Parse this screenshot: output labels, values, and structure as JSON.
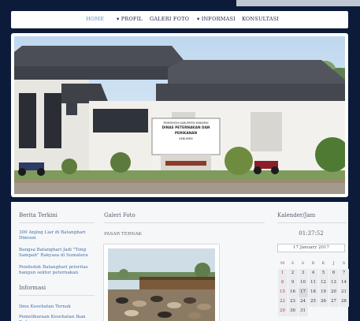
{
  "nav": {
    "items": [
      {
        "label": "HOME",
        "active": true
      },
      {
        "label": "▾ PROFIL"
      },
      {
        "label": "GALERI FOTO"
      },
      {
        "label": "▾ INFORMASI"
      },
      {
        "label": "KONSULTASI"
      }
    ]
  },
  "hero": {
    "building_sign_lines": [
      "PEMERINTAH KABUPATEN KEBUMEN",
      "DINAS PETERNAKAN DAN PERIKANAN",
      "",
      "KEBUMEN"
    ]
  },
  "berita": {
    "title": "Berita Terkini",
    "links": [
      "300 Anjing Liar di Batanghari Dimusn",
      "Bangsa Batanghari Jadi \"Tong Sampah\" Rakyasa di Sumatera",
      "Penduduk Batanghari prioritas bangun sektor peternakan"
    ],
    "info_title": "Informasi",
    "info_links": [
      "Ilmu Kesehatan Ternak",
      "Pemeliharaan Kesehatan Ikan Pada"
    ]
  },
  "galeri": {
    "title": "Galeri Foto",
    "caption": "PASAR TERNAK"
  },
  "kalender": {
    "title": "Kalender/Jam",
    "clock": "01:37:52",
    "date_value": "17 January 2017",
    "day_headers": [
      "M",
      "S",
      "S",
      "R",
      "K",
      "J",
      "S"
    ],
    "weeks": [
      [
        "1",
        "2",
        "3",
        "4",
        "5",
        "6",
        "7"
      ],
      [
        "8",
        "9",
        "10",
        "11",
        "12",
        "13",
        "14"
      ],
      [
        "15",
        "16",
        "17",
        "18",
        "19",
        "20",
        "21"
      ],
      [
        "22",
        "23",
        "24",
        "25",
        "26",
        "27",
        "28"
      ],
      [
        "29",
        "30",
        "31",
        "",
        "",
        "",
        ""
      ]
    ],
    "today": "17"
  },
  "colors": {
    "background": "#0c1b3a",
    "link": "#3f6fa8",
    "nav_active": "#6a8fc4",
    "sunday": "#c0392b"
  }
}
